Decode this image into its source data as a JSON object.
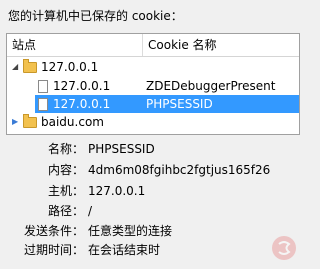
{
  "dialog": {
    "header": "您的计算机中已保存的 cookie："
  },
  "list": {
    "columns": {
      "site": "站点",
      "cookie_name": "Cookie 名称"
    },
    "rows": [
      {
        "site": "127.0.0.1",
        "cookie_name": ""
      },
      {
        "site": "127.0.0.1",
        "cookie_name": "ZDEDebuggerPresent"
      },
      {
        "site": "127.0.0.1",
        "cookie_name": "PHPSESSID"
      },
      {
        "site": "baidu.com",
        "cookie_name": ""
      }
    ]
  },
  "details": {
    "name": {
      "label": "名称：",
      "value": "PHPSESSID"
    },
    "content": {
      "label": "内容：",
      "value": "4dm6m08fgihbc2fgtjus165f26"
    },
    "host": {
      "label": "主机：",
      "value": "127.0.0.1"
    },
    "path": {
      "label": "路径：",
      "value": "/"
    },
    "send_for": {
      "label": "发送条件：",
      "value": "任意类型的连接"
    },
    "expires": {
      "label": "过期时间：",
      "value": "在会话结束时"
    }
  }
}
